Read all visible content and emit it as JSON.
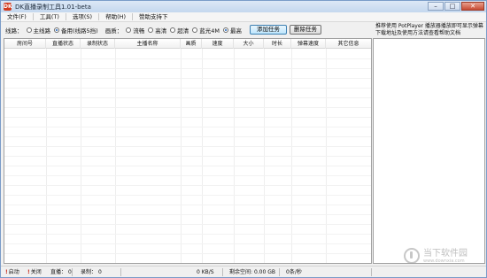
{
  "window": {
    "title": "DK直播录制工具1.01-beta",
    "icon": "app-icon",
    "icon_text": "DK",
    "controls": {
      "minimize": "–",
      "maximize": "□",
      "close": "✕"
    }
  },
  "menu": [
    "文件(F)",
    "工具(T)",
    "选项(S)",
    "帮助(H)",
    "赞助支持下"
  ],
  "toolbar": {
    "line_label": "线路：",
    "line_options": [
      {
        "label": "主线路",
        "selected": false
      },
      {
        "label": "备用(线路5挡)",
        "selected": true
      }
    ],
    "quality_label": "画质：",
    "quality_options": [
      {
        "label": "流畅",
        "selected": false
      },
      {
        "label": "高清",
        "selected": false
      },
      {
        "label": "超清",
        "selected": false
      },
      {
        "label": "蓝光4M",
        "selected": false
      },
      {
        "label": "最高",
        "selected": true
      }
    ],
    "add_task": "添加任务",
    "delete_task": "删除任务"
  },
  "info_text": "推荐使用 PotPlayer 播放器播放即可显示弹幕下载地址及使用方法请查看帮助文档",
  "table": {
    "columns": [
      "房间号",
      "直播状态",
      "录制状态",
      "主播名称",
      "画质",
      "速度",
      "大小",
      "时长",
      "弹幕速度",
      "其它信息"
    ],
    "rows": []
  },
  "status": {
    "start": "启动",
    "close": "关闭",
    "live_label": "直播：",
    "live_count": "0",
    "record_label": "录制：",
    "record_count": "0",
    "speed": "0 KB/S",
    "disk_label": "剩余空间:",
    "disk_value": "0.00 GB",
    "danmaku": "0条/秒"
  },
  "watermark": {
    "cn": "当下软件园",
    "en": "www.downxia.com"
  },
  "colors": {
    "accent": "#3c7fb1",
    "border": "#a0a0a0",
    "close": "#c74a32"
  }
}
